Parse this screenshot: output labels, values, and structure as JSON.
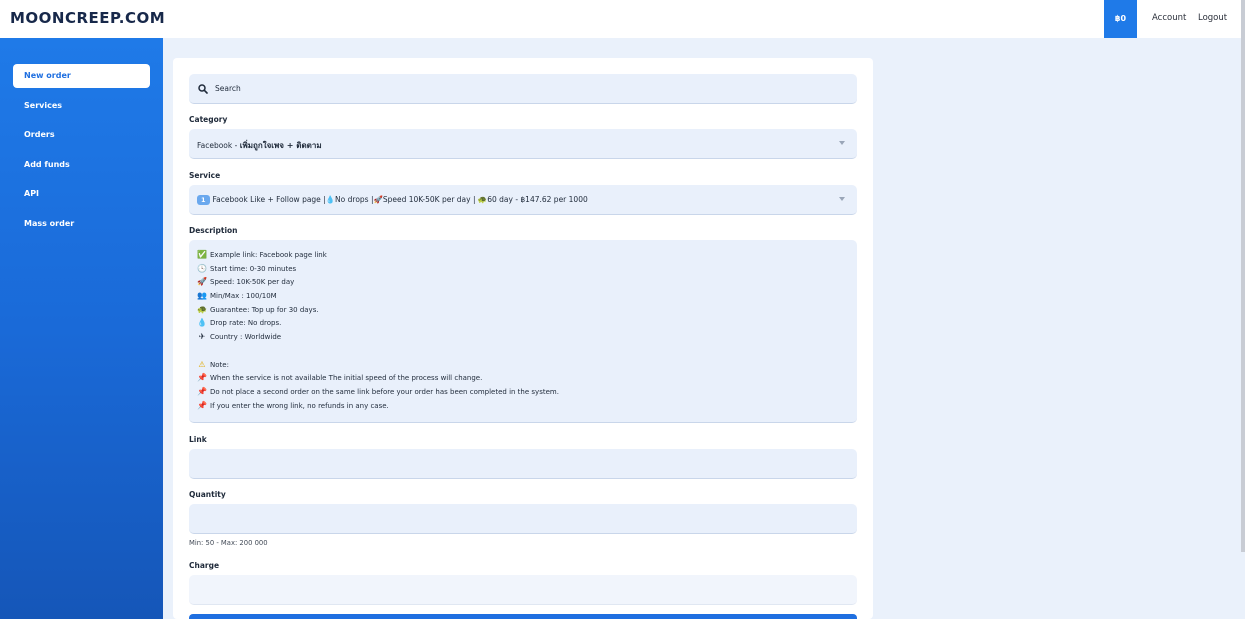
{
  "header": {
    "logo": "MOONCREEP.COM",
    "balance": "฿0",
    "account": "Account",
    "logout": "Logout"
  },
  "sidebar": {
    "items": [
      {
        "label": "New order",
        "active": true
      },
      {
        "label": "Services"
      },
      {
        "label": "Orders"
      },
      {
        "label": "Add funds"
      },
      {
        "label": "API"
      },
      {
        "label": "Mass order"
      }
    ]
  },
  "form": {
    "search_placeholder": "Search",
    "category_label": "Category",
    "category_value_prefix": "Facebook - ",
    "category_value_thai": "เพิ่มถูกใจเพจ + ติดตาม",
    "service_label": "Service",
    "service_badge": "1",
    "service_value": "Facebook Like + Follow page |💧No drops |🚀Speed 10K-50K per day | 🐢60 day - ฿147.62 per 1000",
    "description_label": "Description",
    "description_lines": [
      {
        "icon": "✅",
        "text": "Example link: Facebook page link"
      },
      {
        "icon": "🕓",
        "text": "Start time: 0-30 minutes"
      },
      {
        "icon": "🚀",
        "text": "Speed: 10K-50K per day"
      },
      {
        "icon": "👥",
        "text": "Min/Max : 100/10M"
      },
      {
        "icon": "🐢",
        "text": "Guarantee: Top up for 30 days."
      },
      {
        "icon": "💧",
        "text": "Drop rate: No drops."
      },
      {
        "icon": "✈",
        "text": "Country : Worldwide"
      },
      {
        "icon": "",
        "text": ""
      },
      {
        "icon": "⚠",
        "text": "Note:"
      },
      {
        "icon": "📌",
        "text": "When the service is not available The initial speed of the process will change."
      },
      {
        "icon": "📌",
        "text": "Do not place a second order on the same link before your order has been completed in the system."
      },
      {
        "icon": "📌",
        "text": "If you enter the wrong link, no refunds in any case."
      }
    ],
    "link_label": "Link",
    "link_value": "",
    "quantity_label": "Quantity",
    "quantity_value": "",
    "quantity_hint": "Min: 50 - Max: 200 000",
    "charge_label": "Charge",
    "charge_value": ""
  },
  "colors": {
    "accent": "#1f7ae8",
    "sidebar_bottom": "#1556b8",
    "field_bg": "#e9f0fb",
    "page_bg": "#eaf1fb"
  }
}
